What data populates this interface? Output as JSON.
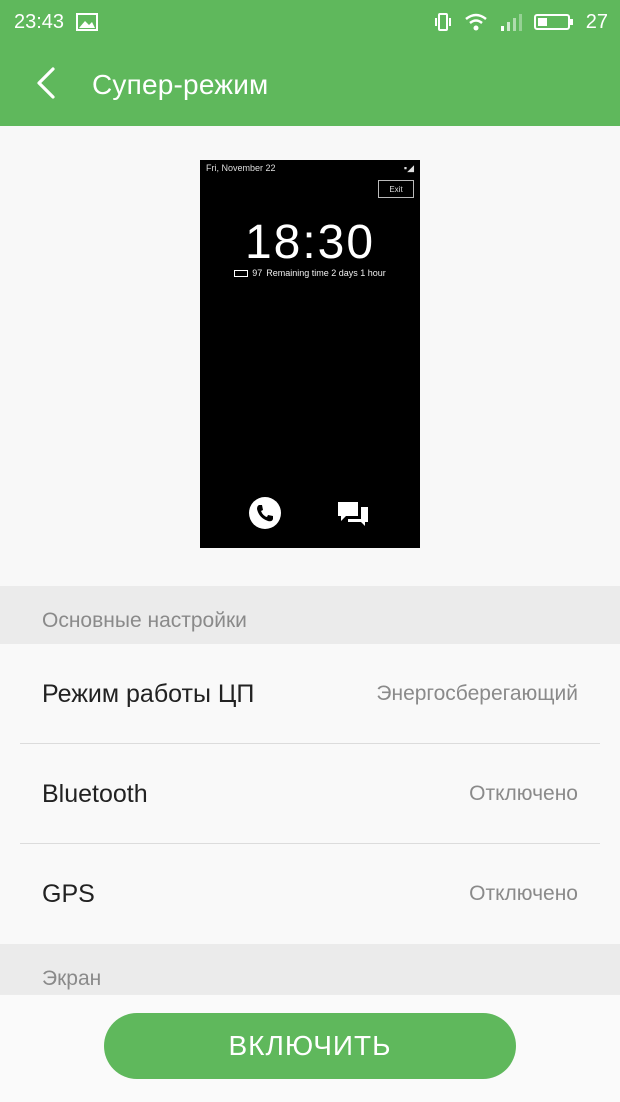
{
  "status_bar": {
    "time": "23:43",
    "battery_level": "27",
    "icons": [
      "image-icon",
      "vibrate-icon",
      "wifi-icon",
      "signal-icon",
      "battery-icon"
    ]
  },
  "app_bar": {
    "title": "Супер-режим",
    "back_icon": "chevron-left-icon"
  },
  "preview": {
    "date": "Fri, November 22",
    "exit_label": "Exit",
    "time": "18:30",
    "battery_percent": "97",
    "remaining": "Remaining time 2 days 1 hour",
    "icons": [
      "phone-icon",
      "messages-icon"
    ]
  },
  "sections": [
    {
      "header": "Основные настройки",
      "rows": [
        {
          "label": "Режим работы ЦП",
          "value": "Энергосберегающий"
        },
        {
          "label": "Bluetooth",
          "value": "Отключено"
        },
        {
          "label": "GPS",
          "value": "Отключено"
        }
      ]
    },
    {
      "header": "Экран"
    }
  ],
  "actions": {
    "enable_label": "ВКЛЮЧИТЬ"
  },
  "colors": {
    "accent": "#5fb85c",
    "background": "#f4f4f4"
  }
}
